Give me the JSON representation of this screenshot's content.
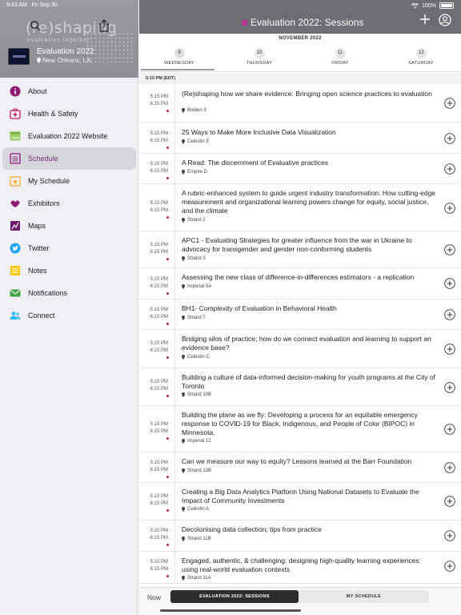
{
  "status": {
    "time": "9:43 AM",
    "date": "Fri Sep 30",
    "battery": "100%"
  },
  "sidebar": {
    "brand_wordmark": "(re)shaping",
    "brand_tagline": "evaluation together",
    "event_name": "Evaluation 2022",
    "event_location": "New Orleans, LA",
    "items": [
      {
        "label": "About",
        "icon": "info-icon",
        "color": "#8e1b72"
      },
      {
        "label": "Health & Safety",
        "icon": "first-aid-kit-icon",
        "color": "#c2185b"
      },
      {
        "label": "Evaluation 2022 Website",
        "icon": "web-icon",
        "color": "#7cb342"
      },
      {
        "label": "Schedule",
        "icon": "calendar-list-icon",
        "color": "#8e1b72"
      },
      {
        "label": "My Schedule",
        "icon": "star-calendar-icon",
        "color": "#f9a825"
      },
      {
        "label": "Exhibitors",
        "icon": "handshake-icon",
        "color": "#8e1b72"
      },
      {
        "label": "Maps",
        "icon": "map-icon",
        "color": "#6a1b6e"
      },
      {
        "label": "Twitter",
        "icon": "twitter-icon",
        "color": "#1da1f2"
      },
      {
        "label": "Notes",
        "icon": "notes-icon",
        "color": "#f9c400"
      },
      {
        "label": "Notifications",
        "icon": "mail-icon",
        "color": "#43a047"
      },
      {
        "label": "Connect",
        "icon": "people-icon",
        "color": "#29b6f6"
      }
    ]
  },
  "header": {
    "title": "Evaluation 2022: Sessions"
  },
  "dates": {
    "month": "NOVEMBER 2022",
    "days": [
      {
        "num": "9",
        "name": "WEDNESDAY"
      },
      {
        "num": "10",
        "name": "THURSDAY"
      },
      {
        "num": "11",
        "name": "FRIDAY"
      },
      {
        "num": "12",
        "name": "SATURDAY"
      }
    ]
  },
  "time_header": "5:15 PM (EDT)",
  "sessions": [
    {
      "start": "5:15 PM",
      "end": "6:15 PM",
      "title": "(Re)shaping how we share evidence: Bringing open science practices to evaluation",
      "location": "Bolden 3"
    },
    {
      "start": "5:15 PM",
      "end": "6:15 PM",
      "title": "25 Ways to Make More Inclusive Data Visualization",
      "location": "Celestin E"
    },
    {
      "start": "5:15 PM",
      "end": "6:15 PM",
      "title": "A Read: The discernment of Evaluative practices",
      "location": "Empire D"
    },
    {
      "start": "5:15 PM",
      "end": "6:15 PM",
      "title": "A rubric-enhanced system to guide urgent industry transformation: How cutting-edge measurement and organizational learning powers change for equity, social justice, and the climate",
      "location": "Strand 2"
    },
    {
      "start": "5:15 PM",
      "end": "6:15 PM",
      "title": "APC1 - Evaluating Strategies for greater influence from the war in Ukraine to advocacy for transgender and gender non-conforming students",
      "location": "Strand 3"
    },
    {
      "start": "5:15 PM",
      "end": "6:15 PM",
      "title": "Assessing the new class of difference-in-differences estimators - a replication",
      "location": "Imperial 5A"
    },
    {
      "start": "5:15 PM",
      "end": "6:15 PM",
      "title": "BH1- Complexity of Evaluation in Behavioral Health",
      "location": "Strand 7"
    },
    {
      "start": "5:15 PM",
      "end": "6:15 PM",
      "title": "Bridging silos of practice; how do we connect evaluation and learning to support an evidence base?",
      "location": "Celestin C"
    },
    {
      "start": "5:15 PM",
      "end": "6:15 PM",
      "title": "Building a culture of data-informed decision-making for youth programs at the City of Toronto",
      "location": "Strand 10B"
    },
    {
      "start": "5:15 PM",
      "end": "6:15 PM",
      "title": "Building the plane as we fly: Developing a process for an equitable emergency response to COVID-19 for Black, Indigenous, and People of Color (BIPOC) in Minnesota.",
      "location": "Imperial 12"
    },
    {
      "start": "5:15 PM",
      "end": "6:15 PM",
      "title": "Can we measure our way to equity? Lessons learned at the Barr Foundation",
      "location": "Strand 13B"
    },
    {
      "start": "5:15 PM",
      "end": "6:15 PM",
      "title": "Creating a Big Data Analytics Platform Using National Datasets to Evaluate the Impact of Community Investments",
      "location": "Celestin A"
    },
    {
      "start": "5:15 PM",
      "end": "6:15 PM",
      "title": "Decolonising data collection; tips from practice",
      "location": "Strand 11B"
    },
    {
      "start": "5:15 PM",
      "end": "6:15 PM",
      "title": "Engaged, authentic, & challenging: designing high-quality learning experiences using real-world evaluation contexts",
      "location": "Strand 11A"
    }
  ],
  "bottom": {
    "now_label": "Now",
    "tab_sessions": "EVALUATION 2022: SESSIONS",
    "tab_my_schedule": "MY SCHEDULE"
  }
}
